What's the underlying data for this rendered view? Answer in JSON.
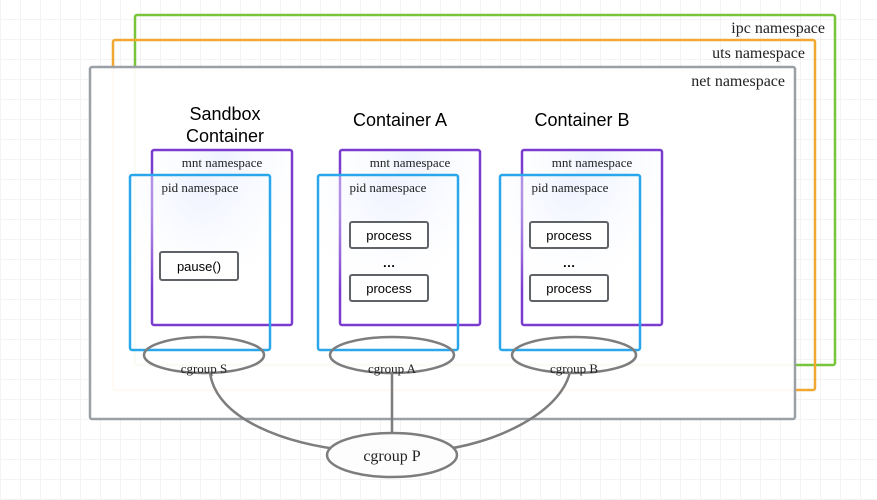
{
  "namespaces": {
    "ipc": "ipc namespace",
    "uts": "uts namespace",
    "net": "net namespace"
  },
  "containers": [
    {
      "title_line1": "Sandbox",
      "title_line2": "Container",
      "mnt": "mnt namespace",
      "pid": "pid namespace",
      "body_type": "pause",
      "pause_label": "pause()",
      "cgroup": "cgroup S"
    },
    {
      "title_line1": "Container A",
      "title_line2": "",
      "mnt": "mnt namespace",
      "pid": "pid namespace",
      "body_type": "processes",
      "proc1": "process",
      "dots": "…",
      "proc2": "process",
      "cgroup": "cgroup A"
    },
    {
      "title_line1": "Container B",
      "title_line2": "",
      "mnt": "mnt namespace",
      "pid": "pid namespace",
      "body_type": "processes",
      "proc1": "process",
      "dots": "…",
      "proc2": "process",
      "cgroup": "cgroup B"
    }
  ],
  "parent_cgroup": "cgroup P"
}
